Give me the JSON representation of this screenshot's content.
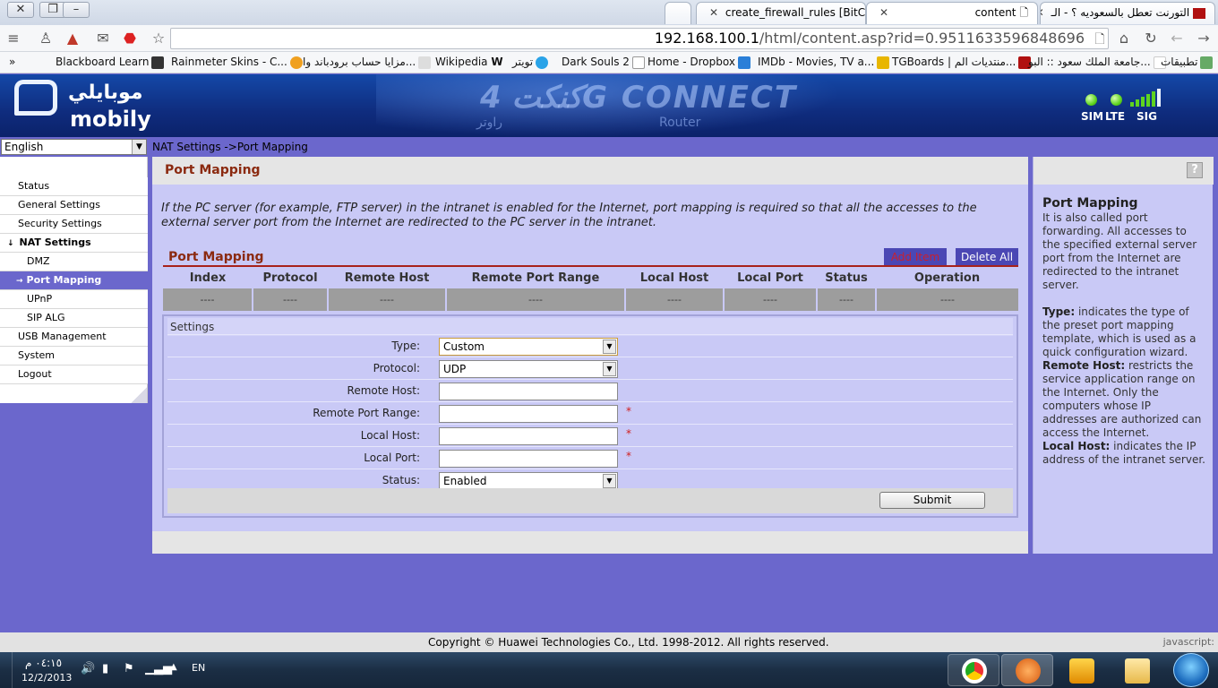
{
  "browser": {
    "tabs": [
      {
        "title": "create_firewall_rules [BitCo"
      },
      {
        "title": "content"
      },
      {
        "title": "التورنت تعطل بالسعوديه ؟ - الـ"
      }
    ],
    "url_host": "192.168.100.1",
    "url_path": "/html/content.asp?rid=0.9511633596848696",
    "bookmarks": [
      "Blackboard Learn",
      "Rainmeter Skins - C...",
      "مزايا حساب برودباند وا...",
      "Wikipedia",
      "تويتر",
      "Dark Souls 2",
      "Home - Dropbox",
      "IMDb - Movies, TV a...",
      "TGBoards | منتديات الم...",
      "جامعة الملك سعود :: البو...",
      "تطبيقات"
    ],
    "bookmarks_overflow": "»"
  },
  "banner": {
    "logo_ar": "موبايلي",
    "logo_en": "mobily",
    "brand": "كنكت 4G CONNECT",
    "brand_ar_sub": "راوتر",
    "brand_sub": "Router",
    "indicators": [
      "SIM",
      "LTE",
      "SIG"
    ]
  },
  "language": {
    "selected": "English"
  },
  "breadcrumb": "NAT Settings ->Port Mapping",
  "sidebar": {
    "items": [
      {
        "label": "Status"
      },
      {
        "label": "General Settings"
      },
      {
        "label": "Security Settings"
      },
      {
        "label": "NAT Settings"
      },
      {
        "label": "DMZ"
      },
      {
        "label": "Port Mapping"
      },
      {
        "label": "UPnP"
      },
      {
        "label": "SIP ALG"
      },
      {
        "label": "USB Management"
      },
      {
        "label": "System"
      },
      {
        "label": "Logout"
      }
    ]
  },
  "main": {
    "title": "Port Mapping",
    "description": "If the PC server (for example, FTP server) in the intranet is enabled for the Internet, port mapping is required so that all the accesses to the external server port from the Internet are redirected to the PC server in the intranet.",
    "section_title": "Port Mapping",
    "add_label": "Add Item",
    "delete_label": "Delete All",
    "table": {
      "headers": [
        "Index",
        "Protocol",
        "Remote Host",
        "Remote Port Range",
        "Local Host",
        "Local Port",
        "Status",
        "Operation"
      ],
      "row": [
        "----",
        "----",
        "----",
        "----",
        "----",
        "----",
        "----",
        "----"
      ]
    },
    "settings": {
      "title": "Settings",
      "type_label": "Type:",
      "type_value": "Custom",
      "protocol_label": "Protocol:",
      "protocol_value": "UDP",
      "remote_host_label": "Remote Host:",
      "remote_host_value": "",
      "remote_port_label": "Remote Port Range:",
      "remote_port_value": "",
      "local_host_label": "Local Host:",
      "local_host_value": "",
      "local_port_label": "Local Port:",
      "local_port_value": "",
      "status_label": "Status:",
      "status_value": "Enabled",
      "required_mark": "*",
      "submit_label": "Submit"
    }
  },
  "help": {
    "title": "Port Mapping",
    "intro": "It is also called port forwarding. All accesses to the specified external server port from the Internet are redirected to the intranet server.",
    "type_term": "Type:",
    "type_text": " indicates the type of the preset port mapping template, which is used as a quick configuration wizard.",
    "remote_term": "Remote Host:",
    "remote_text": " restricts the service application range on the Internet. Only the computers whose IP addresses are authorized can access the Internet.",
    "local_term": "Local Host:",
    "local_text": " indicates the IP address of the intranet server."
  },
  "footer": {
    "copyright": "Copyright © Huawei Technologies Co., Ltd. 1998-2012. All rights reserved.",
    "status_text": "javascript:"
  },
  "taskbar": {
    "time": "٠٤:١٥ م",
    "date": "12/2/2013",
    "language": "EN"
  },
  "colors": {
    "page_bg": "#6b67cc",
    "panel_bg": "#c9c9f6",
    "title_red": "#8b2a10",
    "button_blue": "#4b47b4"
  }
}
